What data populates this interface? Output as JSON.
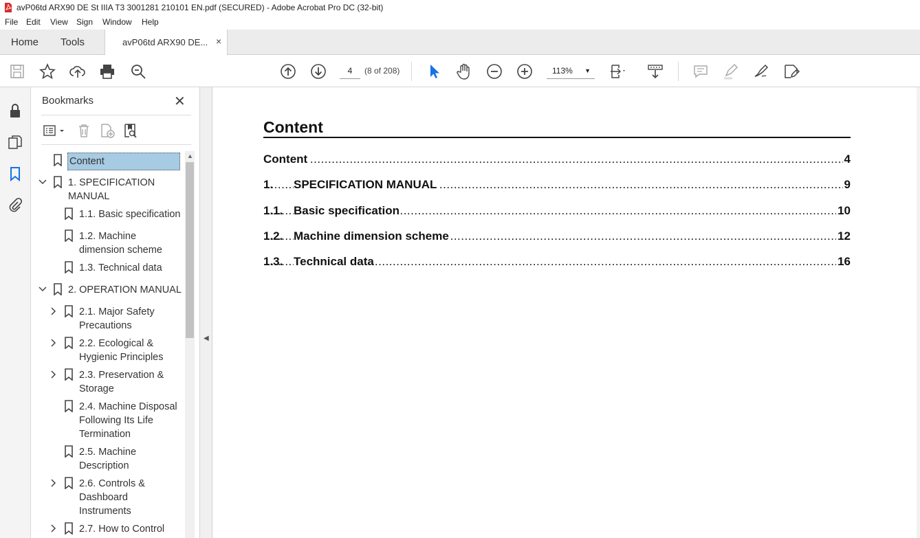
{
  "window": {
    "title": "avP06td ARX90 DE St IIIA T3 3001281 210101 EN.pdf (SECURED) - Adobe Acrobat Pro DC (32-bit)",
    "pdf_icon_color": "#d92b2b"
  },
  "menu": [
    "File",
    "Edit",
    "View",
    "Sign",
    "Window",
    "Help"
  ],
  "tabs": {
    "home": "Home",
    "tools": "Tools",
    "document": "avP06td ARX90 DE...",
    "close": "×"
  },
  "toolbar": {
    "icons": [
      "save-icon",
      "star-icon",
      "upload-icon",
      "print-icon",
      "zoom-search-icon",
      "page-up-icon",
      "page-down-icon",
      "select-arrow-icon",
      "hand-icon",
      "zoom-out-icon",
      "zoom-in-icon",
      "fit-page-icon",
      "scroll-mode-icon",
      "comment-icon",
      "highlight-icon",
      "sign-icon",
      "fill-sign-icon"
    ],
    "page_value": "4",
    "page_of": "(8 of 208)",
    "zoom_value": "113%",
    "accent": "#1473e6"
  },
  "left_rail": {
    "icons": [
      "lock-icon",
      "pages-icon",
      "bookmark-icon",
      "attachment-icon"
    ]
  },
  "bookmarks": {
    "title": "Bookmarks",
    "close": "✕",
    "items": [
      {
        "label": "Content",
        "selected": true,
        "expander": "none"
      },
      {
        "label": "1. SPECIFICATION MANUAL",
        "expander": "expanded"
      },
      {
        "label": "1.1. Basic specification",
        "expander": "none"
      },
      {
        "label": "1.2. Machine dimension scheme",
        "expander": "none"
      },
      {
        "label": "1.3. Technical data",
        "expander": "none"
      },
      {
        "label": "2. OPERATION MANUAL",
        "expander": "expanded"
      },
      {
        "label": "2.1. Major Safety Precautions",
        "expander": "collapsed"
      },
      {
        "label": "2.2. Ecological & Hygienic Principles",
        "expander": "collapsed"
      },
      {
        "label": "2.3. Preservation & Storage",
        "expander": "collapsed"
      },
      {
        "label": "2.4. Machine Disposal Following Its Life Termination",
        "expander": "none"
      },
      {
        "label": "2.5. Machine Description",
        "expander": "none"
      },
      {
        "label": "2.6. Controls & Dashboard Instruments",
        "expander": "collapsed"
      },
      {
        "label": "2.7. How to Control",
        "expander": "collapsed"
      }
    ]
  },
  "document": {
    "heading": "Content",
    "toc": [
      {
        "num": "",
        "label": "Content",
        "page": "4"
      },
      {
        "num": "1.",
        "label": "SPECIFICATION MANUAL",
        "page": "9"
      },
      {
        "num": "1.1.",
        "label": "Basic specification",
        "page": "10"
      },
      {
        "num": "1.2.",
        "label": "Machine dimension scheme",
        "page": "12"
      },
      {
        "num": "1.3.",
        "label": "Technical data",
        "page": "16"
      }
    ],
    "leader": "................................................................................................................................................................................................................................"
  }
}
